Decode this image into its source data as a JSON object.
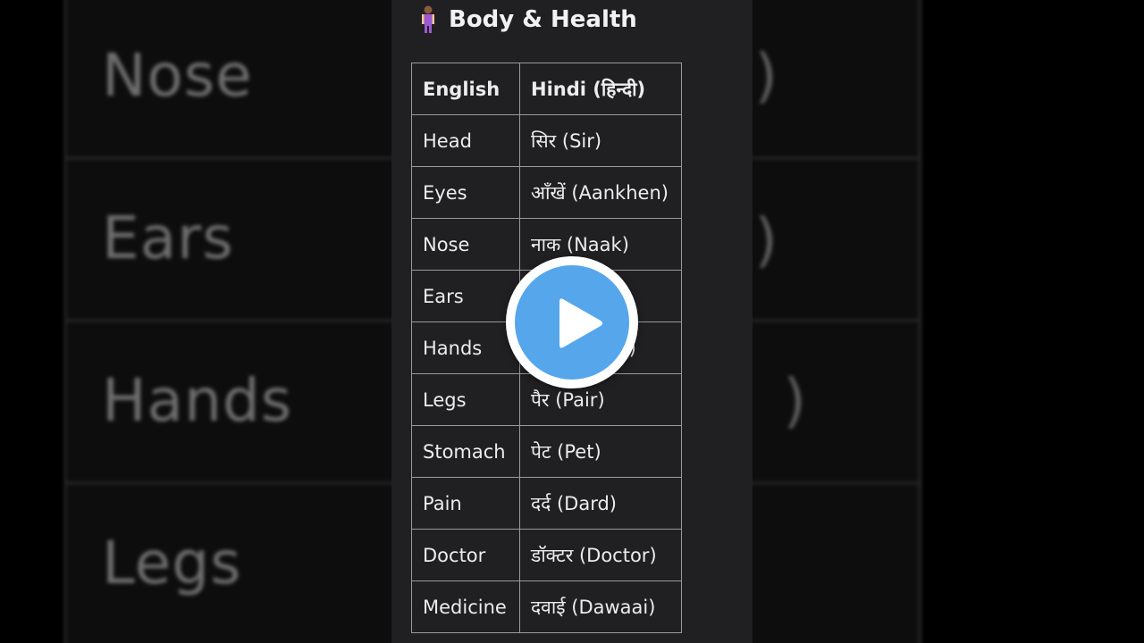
{
  "background": {
    "rows": [
      {
        "word": "Nose",
        "paren": ")"
      },
      {
        "word": "Ears",
        "paren": ")"
      },
      {
        "word": "Hands",
        "paren": ")"
      },
      {
        "word": "Legs",
        "paren": ""
      }
    ]
  },
  "card": {
    "title": "Body & Health",
    "title_icon": "person-standing-icon",
    "columns": [
      "English",
      "Hindi (हिन्दी)"
    ],
    "rows": [
      {
        "english": "Head",
        "hindi": "सिर (Sir)"
      },
      {
        "english": "Eyes",
        "hindi": "आँखें (Aankhen)"
      },
      {
        "english": "Nose",
        "hindi": "नाक (Naak)"
      },
      {
        "english": "Ears",
        "hindi": ""
      },
      {
        "english": "Hands",
        "hindi": ")"
      },
      {
        "english": "Legs",
        "hindi": "पैर (Pair)"
      },
      {
        "english": "Stomach",
        "hindi": "पेट (Pet)"
      },
      {
        "english": "Pain",
        "hindi": "दर्द (Dard)"
      },
      {
        "english": "Doctor",
        "hindi": "डॉक्टर (Doctor)"
      },
      {
        "english": "Medicine",
        "hindi": "दवाई (Dawaai)"
      }
    ]
  },
  "play_button": {
    "icon": "play-icon",
    "color": "#56a6ec"
  }
}
